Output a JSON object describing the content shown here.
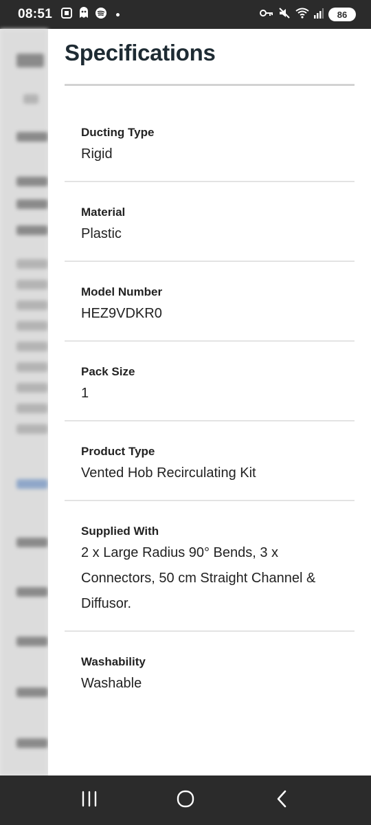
{
  "status_bar": {
    "time": "08:51",
    "battery": "86"
  },
  "drawer": {
    "title": "Specifications",
    "specs": [
      {
        "label": "Ducting Type",
        "value": "Rigid"
      },
      {
        "label": "Material",
        "value": "Plastic"
      },
      {
        "label": "Model Number",
        "value": "HEZ9VDKR0"
      },
      {
        "label": "Pack Size",
        "value": "1"
      },
      {
        "label": "Product Type",
        "value": "Vented Hob Recirculating Kit"
      },
      {
        "label": "Supplied With",
        "value": "2 x Large Radius 90° Bends, 3 x Connectors, 50 cm Straight Channel & Diffusor."
      },
      {
        "label": "Washability",
        "value": "Washable"
      }
    ]
  },
  "icons": {
    "status_left": [
      "screenshot-icon",
      "app-icon",
      "spotify-icon"
    ],
    "status_right": [
      "key-icon",
      "mute-icon",
      "wifi-icon",
      "signal-icon"
    ],
    "nav": [
      "recents-icon",
      "home-icon",
      "back-icon"
    ]
  }
}
